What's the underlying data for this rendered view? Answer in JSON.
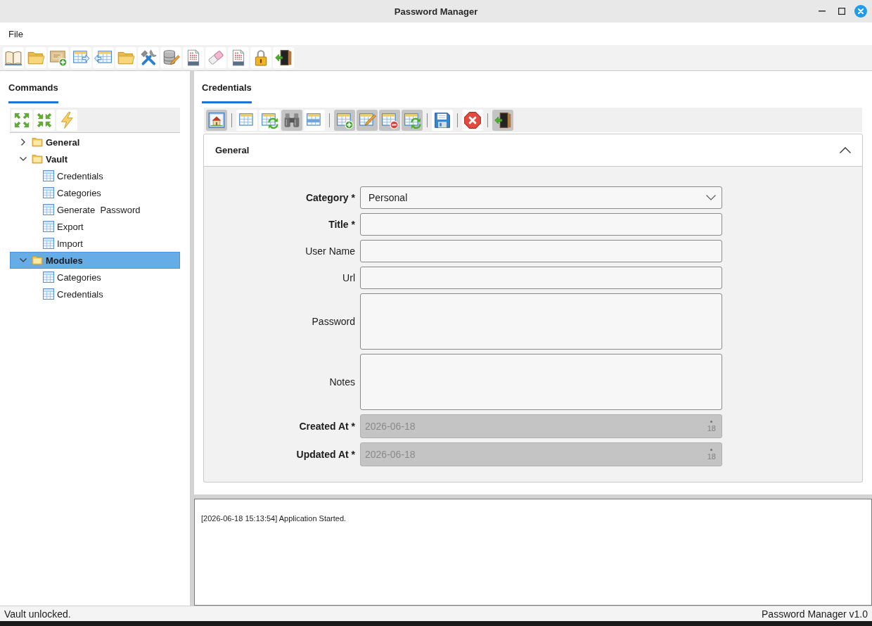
{
  "window": {
    "title": "Password Manager"
  },
  "menu": [
    "File"
  ],
  "toolbar": [
    {
      "kind": "book"
    },
    {
      "kind": "folder"
    },
    {
      "kind": "certificate"
    },
    {
      "kind": "export"
    },
    {
      "kind": "import"
    },
    {
      "kind": "folder"
    },
    {
      "kind": "tools"
    },
    {
      "kind": "database"
    },
    {
      "kind": "log"
    },
    {
      "kind": "eraser"
    },
    {
      "kind": "log"
    },
    {
      "kind": "lock"
    },
    {
      "kind": "exit"
    }
  ],
  "sidebar": {
    "tabs": [
      {
        "label": "Commands",
        "selected": true
      }
    ],
    "tools": [
      {
        "kind": "expand"
      },
      {
        "kind": "collapse"
      },
      {
        "kind": "run"
      }
    ],
    "tree": [
      {
        "label": "General",
        "kind": "folder",
        "expanded": false,
        "selected": false
      },
      {
        "label": "Vault",
        "kind": "folder",
        "expanded": true,
        "selected": false,
        "children": [
          {
            "label": "Credentials",
            "kind": "table",
            "selected": false
          },
          {
            "label": "Categories",
            "kind": "table",
            "selected": false
          },
          {
            "label": "Generate  Password",
            "kind": "table",
            "selected": false
          },
          {
            "label": "Export",
            "kind": "table",
            "selected": false
          },
          {
            "label": "Import",
            "kind": "table",
            "selected": false
          }
        ]
      },
      {
        "label": "Modules",
        "kind": "folder",
        "expanded": true,
        "selected": true,
        "children": [
          {
            "label": "Categories",
            "kind": "table",
            "selected": false
          },
          {
            "label": "Credentials",
            "kind": "table",
            "selected": false
          }
        ]
      }
    ]
  },
  "content": {
    "tabs": [
      {
        "label": "Credentials",
        "selected": true
      }
    ],
    "toolbar": [
      [
        {
          "kind": "home",
          "pressed": true
        }
      ],
      [
        {
          "kind": "grid",
          "pressed": false
        },
        {
          "kind": "grid-refresh",
          "pressed": false
        },
        {
          "kind": "search",
          "pressed": true
        },
        {
          "kind": "grid-row",
          "pressed": false
        }
      ],
      [
        {
          "kind": "grid-add",
          "pressed": true
        },
        {
          "kind": "grid-edit",
          "pressed": true
        },
        {
          "kind": "grid-delete",
          "pressed": true
        },
        {
          "kind": "grid-refresh",
          "pressed": true
        }
      ],
      [
        {
          "kind": "save",
          "pressed": false
        }
      ],
      [
        {
          "kind": "cancel",
          "pressed": false
        }
      ],
      [
        {
          "kind": "exit",
          "pressed": true
        }
      ]
    ],
    "section": {
      "title": "General",
      "expanded": true,
      "fields": [
        {
          "label": "Category *",
          "required": true,
          "kind": "select",
          "value": "Personal",
          "disabled": false
        },
        {
          "label": "Title *",
          "required": true,
          "kind": "text",
          "disabled": false
        },
        {
          "label": "User Name",
          "required": false,
          "kind": "text",
          "disabled": false
        },
        {
          "label": "Url",
          "required": false,
          "kind": "text",
          "disabled": false
        },
        {
          "label": "Password",
          "required": false,
          "kind": "textarea",
          "disabled": false
        },
        {
          "label": "Notes",
          "required": false,
          "kind": "textarea",
          "disabled": false
        },
        {
          "label": "Created At *",
          "required": true,
          "kind": "date",
          "value": "2026-06-18",
          "calendar_day": "18",
          "disabled": true
        },
        {
          "label": "Updated At *",
          "required": true,
          "kind": "date",
          "value": "2026-06-18",
          "calendar_day": "18",
          "disabled": true
        }
      ]
    }
  },
  "log": [
    "[2026-06-18 15:13:54] Application Started."
  ],
  "status_bar": {
    "left": "Vault unlocked.",
    "right": "Password Manager v1.0"
  }
}
